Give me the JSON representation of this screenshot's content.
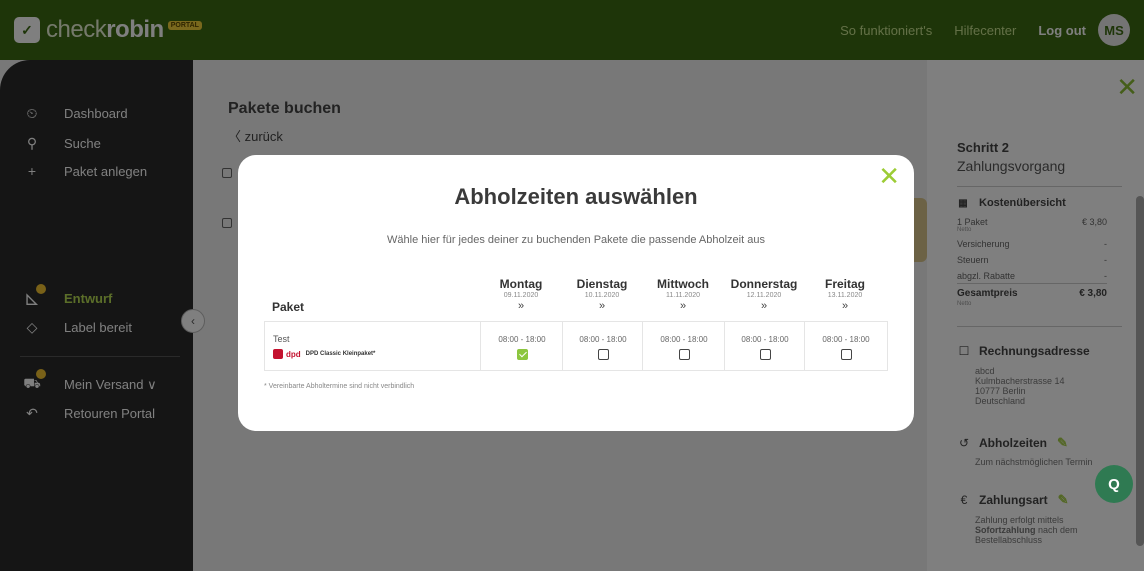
{
  "header": {
    "logo_icon": "✓",
    "logo_text_part1": "check",
    "logo_text_part2": "robin",
    "portal_badge": "PORTAL",
    "nav_how": "So funktioniert's",
    "nav_help": "Hilfecenter",
    "nav_logout": "Log out",
    "avatar_initials": "MS"
  },
  "sidebar": {
    "items": [
      {
        "label": "Dashboard",
        "icon": "⏲"
      },
      {
        "label": "Suche",
        "icon": "⚲"
      },
      {
        "label": "Paket anlegen",
        "icon": "+"
      },
      {
        "label": "Entwurf",
        "icon": "◺"
      },
      {
        "label": "Label bereit",
        "icon": "◇"
      },
      {
        "label": "Mein Versand ∨",
        "icon": "⛟"
      },
      {
        "label": "Retouren Portal",
        "icon": "↶"
      }
    ],
    "collapse_icon": "‹"
  },
  "main": {
    "title": "Pakete buchen",
    "back": "〈 zurück"
  },
  "right_panel": {
    "close_icon": "✕",
    "step": "Schritt 2",
    "step_sub": "Zahlungsvorgang",
    "cost_title": "Kostenübersicht",
    "rows": [
      {
        "label": "1 Paket",
        "value": "€ 3,80"
      },
      {
        "label": "Versicherung",
        "value": "-"
      },
      {
        "label": "Steuern",
        "value": "-"
      },
      {
        "label": "abgzl. Rabatte",
        "value": "-"
      }
    ],
    "netto": "Netto",
    "total_label": "Gesamtpreis",
    "total_value": "€ 3,80",
    "billing_title": "Rechnungsadresse",
    "billing_lines": [
      "abcd",
      "Kulmbacherstrasse 14",
      "10777 Berlin",
      "Deutschland"
    ],
    "pickup_title": "Abholzeiten",
    "pickup_text": "Zum nächstmöglichen Termin",
    "payment_title": "Zahlungsart",
    "payment_text1": "Zahlung erfolgt mittels",
    "payment_text2_bold": "Sofortzahlung",
    "payment_text2": " nach dem",
    "payment_text3": "Bestellabschluss"
  },
  "modal": {
    "close_icon": "✕",
    "title": "Abholzeiten auswählen",
    "description": "Wähle hier für jedes deiner zu buchenden Pakete die passende Abholzeit aus",
    "col_paket": "Paket",
    "days": [
      {
        "name": "Montag",
        "date": "09.11.2020"
      },
      {
        "name": "Dienstag",
        "date": "10.11.2020"
      },
      {
        "name": "Mittwoch",
        "date": "11.11.2020"
      },
      {
        "name": "Donnerstag",
        "date": "12.11.2020"
      },
      {
        "name": "Freitag",
        "date": "13.11.2020"
      }
    ],
    "chevron": "»",
    "package": {
      "name": "Test",
      "carrier_logo": "dpd",
      "product": "DPD Classic Kleinpaket*",
      "slots": [
        {
          "time": "08:00 - 18:00",
          "checked": true
        },
        {
          "time": "08:00 - 18:00",
          "checked": false
        },
        {
          "time": "08:00 - 18:00",
          "checked": false
        },
        {
          "time": "08:00 - 18:00",
          "checked": false
        },
        {
          "time": "08:00 - 18:00",
          "checked": false
        }
      ]
    },
    "footnote": "* Vereinbarte Abholtermine sind nicht verbindlich"
  },
  "chat_icon": "Q",
  "colors": {
    "topbar": "#3c6b13",
    "accent": "#8cc63f",
    "sidebar": "#2a2a2a"
  }
}
